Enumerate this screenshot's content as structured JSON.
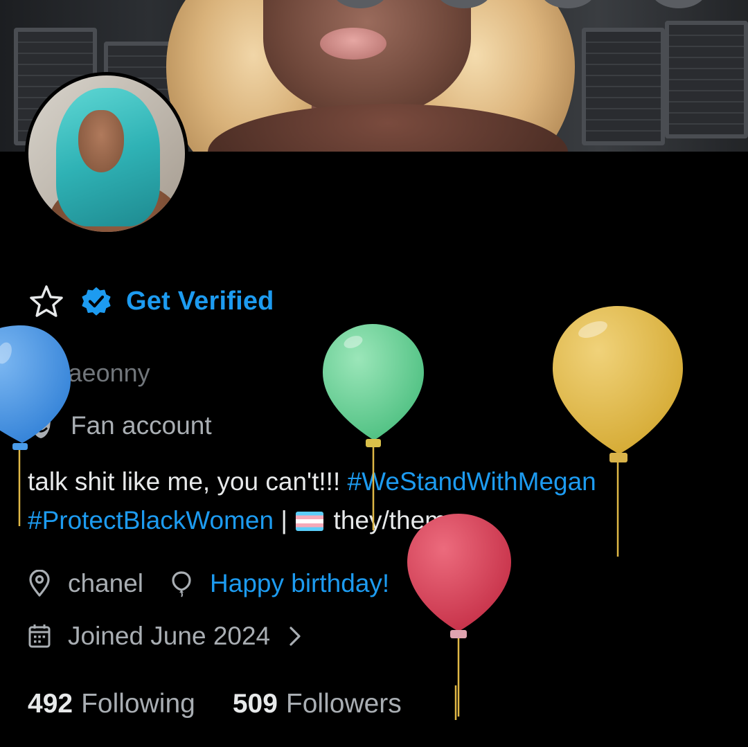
{
  "profile": {
    "get_verified_label": "Get Verified",
    "handle": "@traeonny",
    "category_label": "Fan account",
    "bio": {
      "text": "talk shit like me, you can't!!!",
      "hashtag1": "#WeStandWithMegan",
      "hashtag2": "#ProtectBlackWomen",
      "separator": "|",
      "pronouns": "they/them"
    },
    "location": "chanel",
    "birthday_text": "Happy birthday!",
    "joined": "Joined June 2024",
    "stats": {
      "following_count": "492",
      "following_label": "Following",
      "followers_count": "509",
      "followers_label": "Followers"
    }
  },
  "icons": {
    "star": "star-outline-icon",
    "verified": "verified-badge-icon",
    "category": "theater-mask-icon",
    "location": "location-pin-icon",
    "birthday": "balloon-icon",
    "calendar": "calendar-icon",
    "chevron": "chevron-right-icon",
    "flag": "transgender-flag-icon"
  },
  "colors": {
    "background": "#000000",
    "accent": "#1d9bf0",
    "primary_text": "#e7e9ea",
    "secondary_text": "#71767b",
    "balloon_blue": "#3d8fe0",
    "balloon_green": "#5fce92",
    "balloon_yellow": "#e0b83a",
    "balloon_red": "#d8394f"
  }
}
